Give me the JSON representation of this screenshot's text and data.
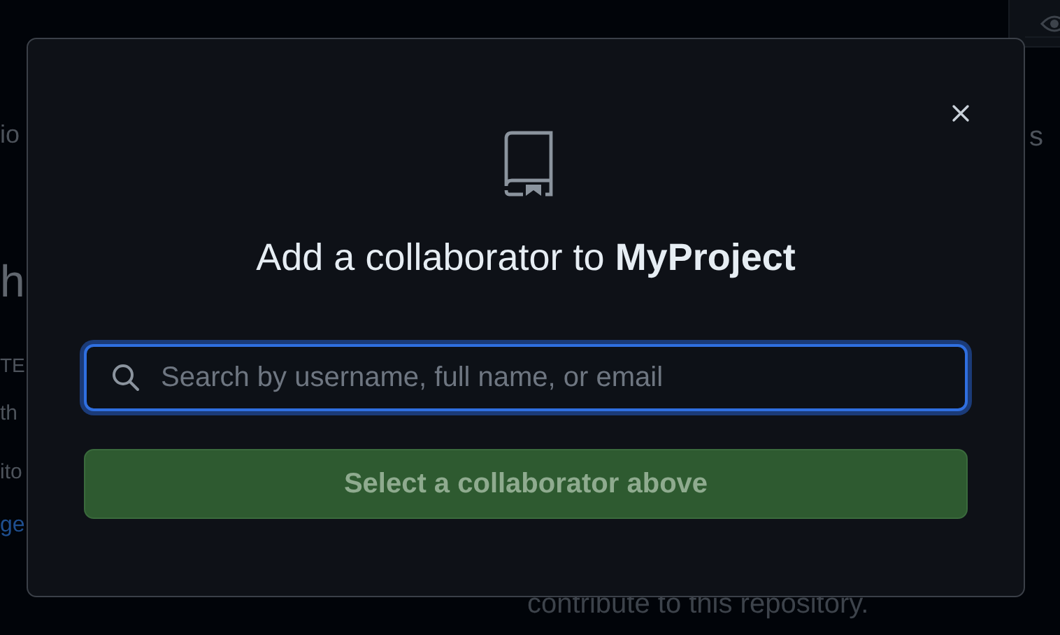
{
  "background": {
    "left_fragments": [
      {
        "text": "io",
        "kind": "tab"
      },
      {
        "text": "h",
        "kind": "heading"
      },
      {
        "text": "TE",
        "kind": "label"
      },
      {
        "text": "th",
        "kind": "body"
      },
      {
        "text": "ito",
        "kind": "body"
      },
      {
        "text": "ge",
        "kind": "link"
      }
    ],
    "right_fragment": "s",
    "bottom_text": "contribute to this repository."
  },
  "dialog": {
    "title_start": "Add a collaborator to ",
    "title_repo": "MyProject",
    "search": {
      "placeholder": "Search by username, full name, or email"
    },
    "button": {
      "label": "Select a collaborator above",
      "disabled": true
    }
  }
}
